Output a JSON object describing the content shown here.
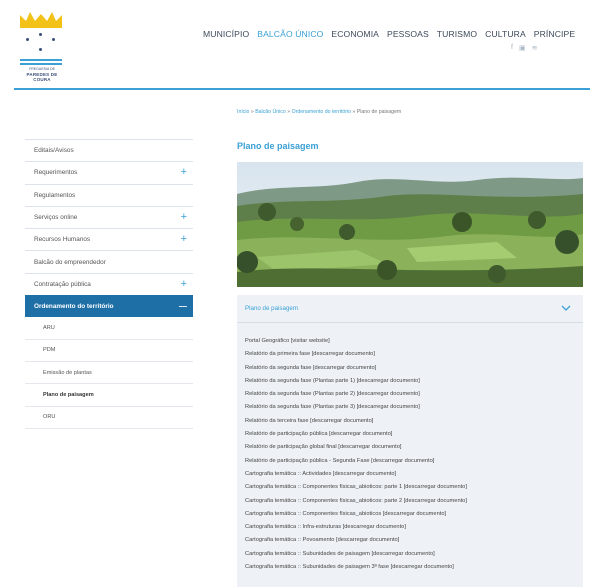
{
  "header": {
    "logo": {
      "line1": "FREGUESIA DE",
      "line2": "PAREDES DE COURA"
    },
    "nav": [
      {
        "label": "MUNICÍPIO",
        "active": false
      },
      {
        "label": "BALCÃO ÚNICO",
        "active": true
      },
      {
        "label": "ECONOMIA",
        "active": false
      },
      {
        "label": "PESSOAS",
        "active": false
      },
      {
        "label": "TURISMO",
        "active": false
      },
      {
        "label": "CULTURA",
        "active": false
      },
      {
        "label": "PRÍNCIPE",
        "active": false
      }
    ],
    "social_icons": [
      "facebook-icon",
      "youtube-icon",
      "rss-icon"
    ]
  },
  "breadcrumb": {
    "items": [
      "Início",
      "Balcão Único",
      "Ordenamento do território"
    ],
    "separator": "»",
    "current": "Plano de paisagem"
  },
  "sidebar": {
    "items": [
      {
        "label": "Editais/Avisos",
        "expandable": false
      },
      {
        "label": "Requerimentos",
        "expandable": true
      },
      {
        "label": "Regulamentos",
        "expandable": false
      },
      {
        "label": "Serviços online",
        "expandable": true
      },
      {
        "label": "Recursos Humanos",
        "expandable": true
      },
      {
        "label": "Balcão do empreendedor",
        "expandable": false
      },
      {
        "label": "Contratação pública",
        "expandable": true
      },
      {
        "label": "Ordenamento do território",
        "expandable": true,
        "expanded": true,
        "collapse_symbol": "—"
      }
    ],
    "sub_items": [
      {
        "label": "ARU",
        "current": false
      },
      {
        "label": "PDM",
        "current": false
      },
      {
        "label": "Emissão de plantas",
        "current": false
      },
      {
        "label": "Plano de paisagem",
        "current": true
      },
      {
        "label": "ORU",
        "current": false
      }
    ],
    "expand_symbol": "+"
  },
  "content": {
    "title": "Plano de paisagem",
    "accordion_title": "Plano de paisagem",
    "documents": [
      "Portal Geográfico  [visitar website]",
      "Relatório da primeira fase  [descarregar documento]",
      "Relatório da segunda fase  [descarregar documento]",
      "Relatório da segunda fase (Plantas parte 1)  [descarregar documento]",
      "Relatório da segunda fase (Plantas parte 2)  [descarregar documento]",
      "Relatório da segunda fase (Plantas parte 3)  [descarregar documento]",
      "Relatório da terceira fase  [descarregar documento]",
      "Relatório de participação pública  [descarregar documento]",
      "Relatório de participação global final  [descarregar documento]",
      "Relatório de participação pública - Segunda Fase  [descarregar documento]",
      "Cartografia temática :: Actividades  [descarregar documento]",
      "Cartografia temática :: Componentes físicas_abioticos: parte 1  [descarregar documento]",
      "Cartografia temática :: Componentes físicas_abioticos: parte 2  [descarregar documento]",
      "Cartografia temática :: Componentes físicas_abioticos  [descarregar documento]",
      "Cartografia temática :: Infra-estruturas  [descarregar documento]",
      "Cartografia temática :: Povoamento  [descarregar documento]",
      "Cartografia temática :: Subunidades de paisagem  [descarregar documento]",
      "Cartografia temática :: Subunidades de paisagem 3ª fase  [descarregar documento]"
    ]
  },
  "colors": {
    "accent": "#3aa0d6",
    "sidebar_active": "#1d6fa6",
    "accordion_bg": "#eef2f6",
    "logo_gold": "#f2c218",
    "logo_blue": "#3a4f7a"
  }
}
